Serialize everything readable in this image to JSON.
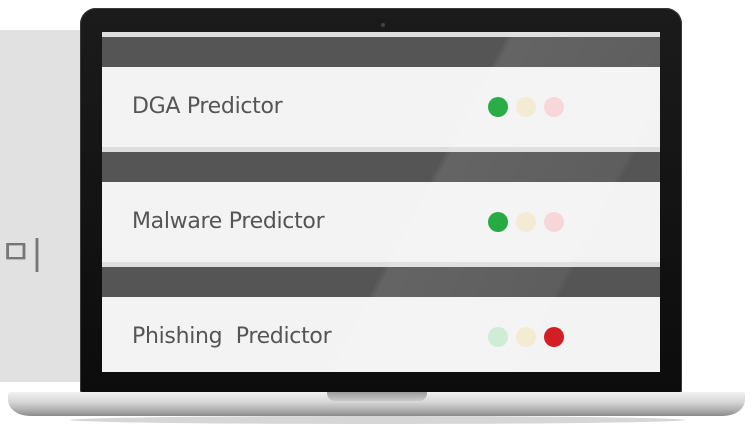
{
  "background": {
    "text_fragment": "ㅁ|"
  },
  "screen": {
    "predictors": [
      {
        "label": "DGA Predictor",
        "status": "green",
        "lights": {
          "green": "on",
          "yellow": "off",
          "red": "off"
        }
      },
      {
        "label": "Malware Predictor",
        "status": "green",
        "lights": {
          "green": "on",
          "yellow": "off",
          "red": "off"
        }
      },
      {
        "label": "Phishing  Predictor",
        "status": "red",
        "lights": {
          "green": "off",
          "yellow": "off",
          "red": "on"
        }
      }
    ]
  },
  "colors": {
    "green_on": "#16a534",
    "red_on": "#d41e25",
    "green_off": "#ccebd2",
    "yellow_off": "#f2ead0",
    "red_off": "#f7d4d7",
    "dark_bar": "#555555",
    "row_background": "#f3f3f3",
    "label_text": "#555555"
  }
}
